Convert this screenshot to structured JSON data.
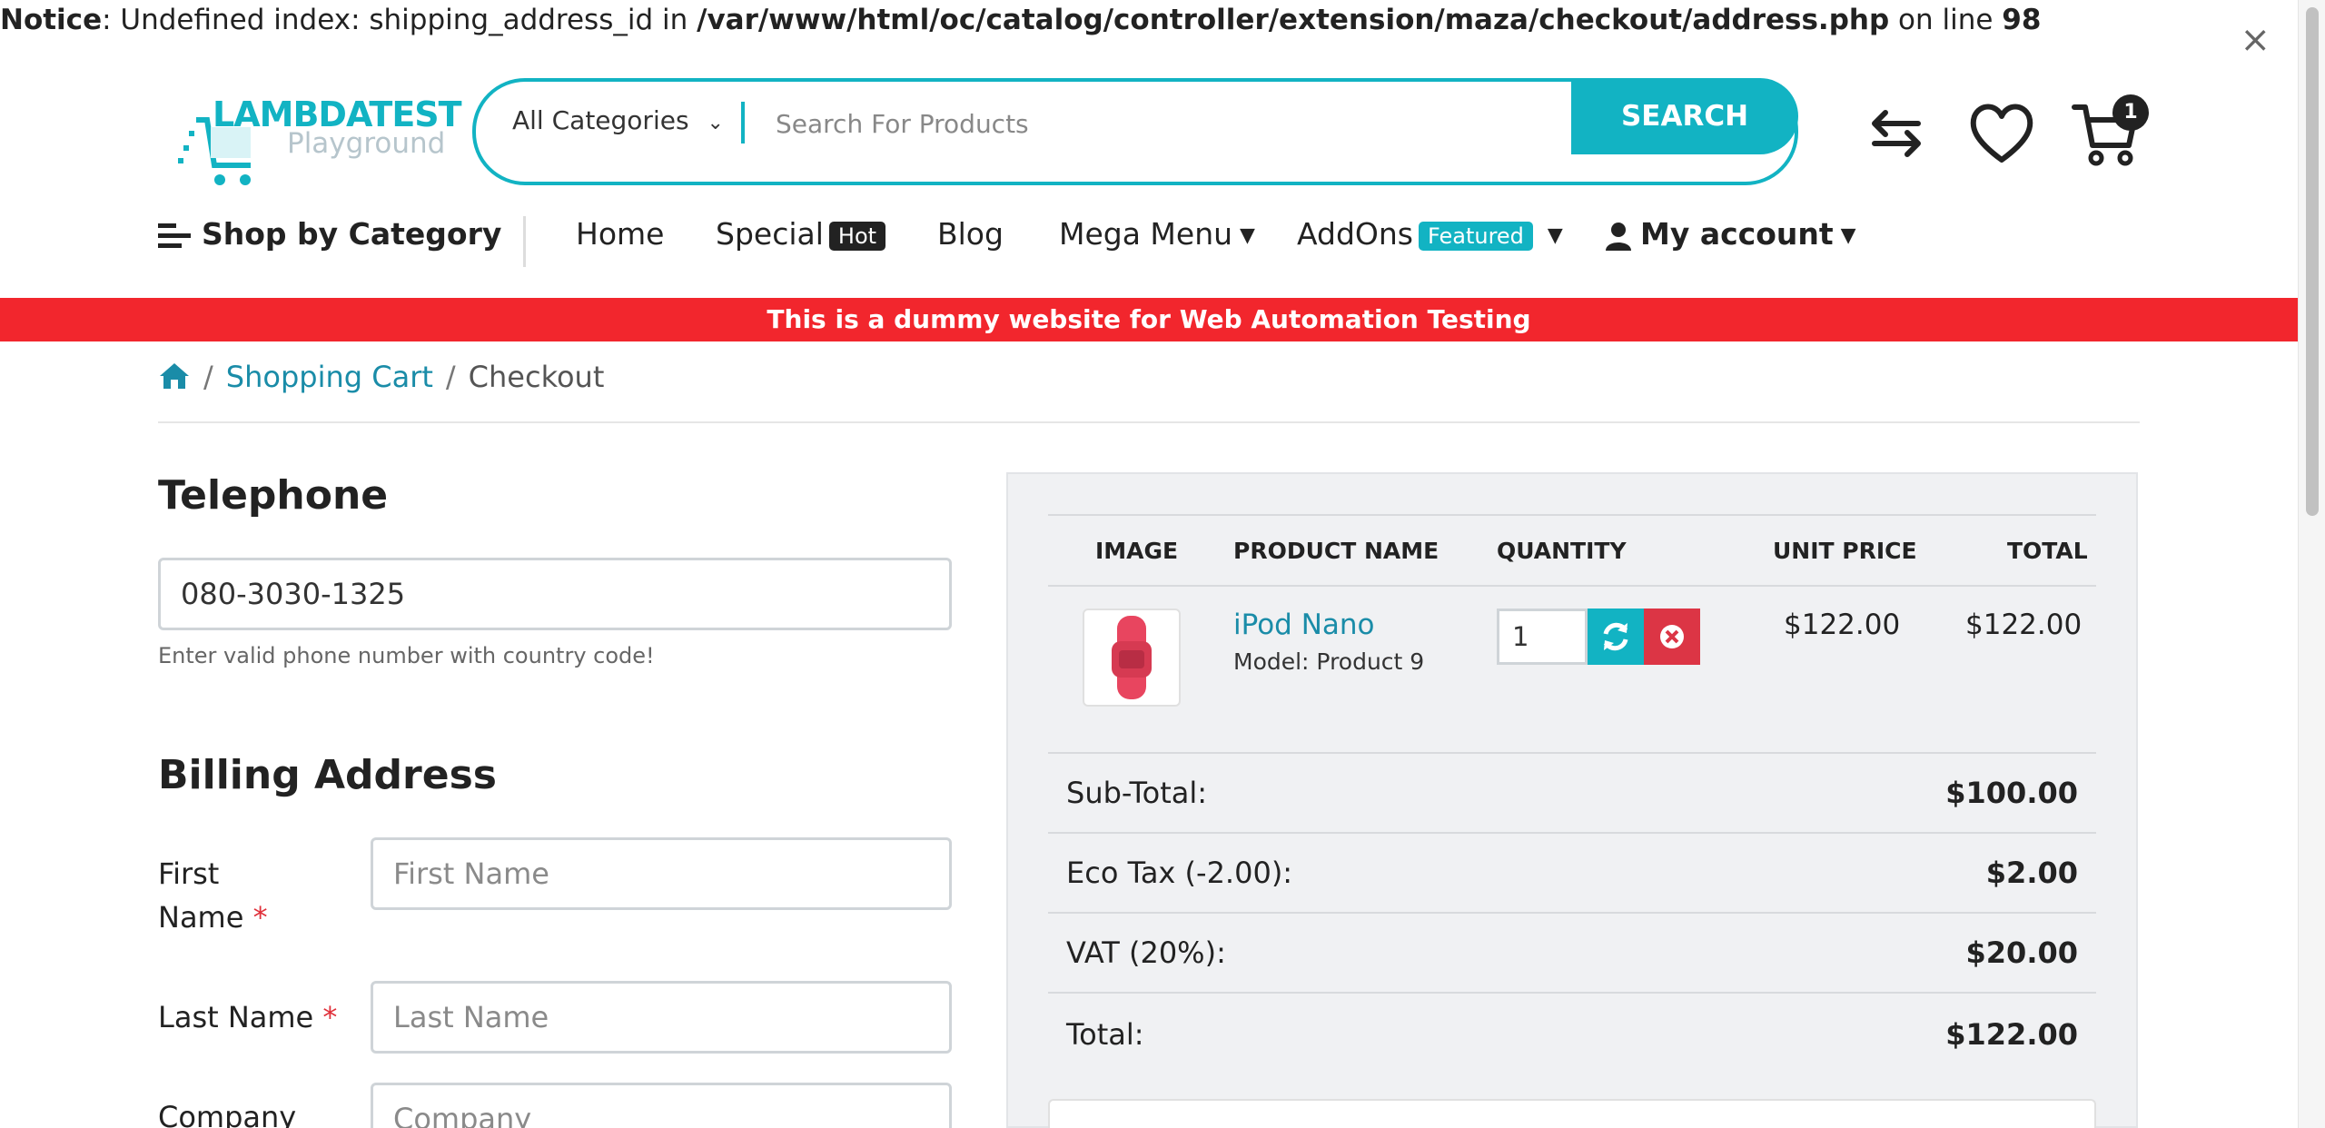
{
  "notice": {
    "prefix": "Notice",
    "message": ": Undefined index: shipping_address_id in ",
    "path": "/var/www/html/oc/catalog/controller/extension/maza/checkout/address.php",
    "on_line": " on line ",
    "line": "98",
    "close": "×"
  },
  "header": {
    "logo_brand": "LAMBDATEST",
    "logo_sub": "Playground",
    "category_select": "All Categories",
    "search_placeholder": "Search For Products",
    "search_button": "SEARCH",
    "cart_count": "1"
  },
  "nav": {
    "shop_by_category": "Shop by Category",
    "home": "Home",
    "special": "Special",
    "special_badge": "Hot",
    "blog": "Blog",
    "mega_menu": "Mega Menu",
    "addons": "AddOns",
    "addons_badge": "Featured",
    "my_account": "My account"
  },
  "banner": "This is a dummy website for Web Automation Testing",
  "breadcrumb": {
    "sep": "/",
    "cart": "Shopping Cart",
    "current": "Checkout"
  },
  "form": {
    "telephone_heading": "Telephone",
    "telephone_value": "080-3030-1325",
    "telephone_help": "Enter valid phone number with country code!",
    "billing_heading": "Billing Address",
    "first_name_label_1": "First",
    "first_name_label_2": "Name",
    "first_name_placeholder": "First Name",
    "last_name_label": "Last Name",
    "last_name_placeholder": "Last Name",
    "company_label": "Company",
    "company_placeholder": "Company",
    "required_mark": "*"
  },
  "cart": {
    "columns": [
      "IMAGE",
      "PRODUCT NAME",
      "QUANTITY",
      "UNIT PRICE",
      "TOTAL"
    ],
    "item": {
      "name": "iPod Nano",
      "model": "Model: Product 9",
      "quantity": "1",
      "unit_price": "$122.00",
      "total": "$122.00"
    },
    "totals": [
      {
        "label": "Sub-Total:",
        "value": "$100.00"
      },
      {
        "label": "Eco Tax (-2.00):",
        "value": "$2.00"
      },
      {
        "label": "VAT (20%):",
        "value": "$20.00"
      },
      {
        "label": "Total:",
        "value": "$122.00"
      }
    ]
  },
  "colors": {
    "accent": "#12b3c3",
    "banner": "#f2262d",
    "link": "#1a8ca8",
    "remove": "#dc3545"
  }
}
